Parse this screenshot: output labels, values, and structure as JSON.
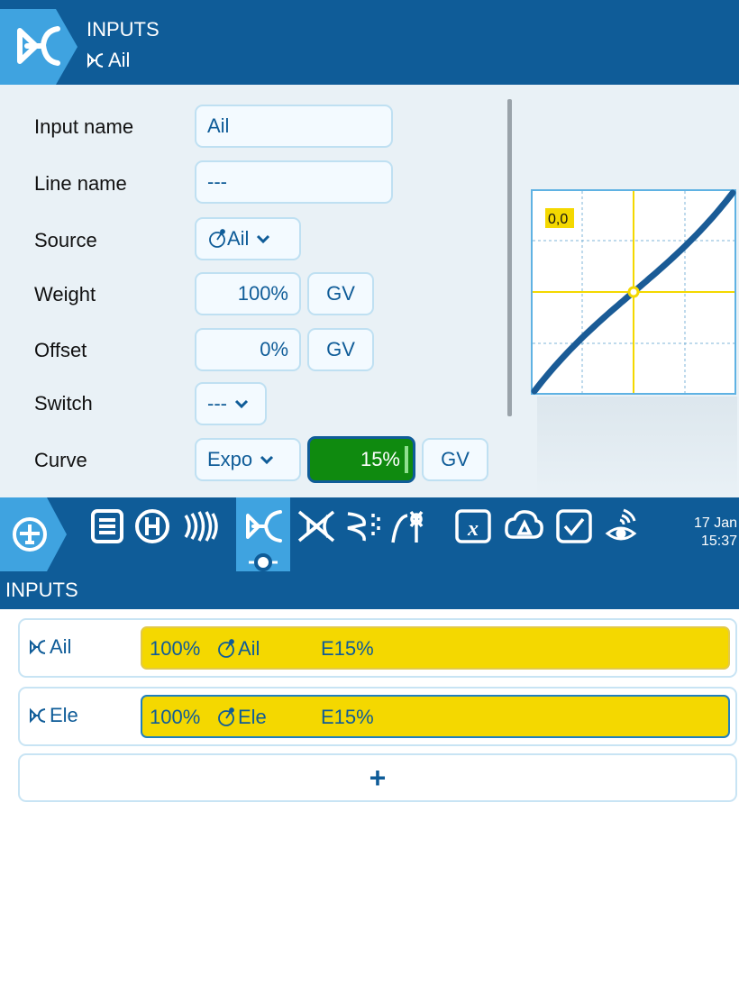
{
  "dialog": {
    "title": "INPUTS",
    "subtitle": "Ail",
    "fields": {
      "input_name": {
        "label": "Input name",
        "value": "Ail"
      },
      "line_name": {
        "label": "Line name",
        "value": "---"
      },
      "source": {
        "label": "Source",
        "value": "Ail"
      },
      "weight": {
        "label": "Weight",
        "value": "100%",
        "gv_label": "GV"
      },
      "offset": {
        "label": "Offset",
        "value": "0%",
        "gv_label": "GV"
      },
      "switch": {
        "label": "Switch",
        "value": "---"
      },
      "curve": {
        "label": "Curve",
        "type": "Expo",
        "value": "15%",
        "gv_label": "GV"
      }
    },
    "preview": {
      "readout": "0,0",
      "expo_percent": 15,
      "cursor": [
        0,
        0
      ]
    }
  },
  "topbar": {
    "icons": [
      "model-setup-icon",
      "notes-icon",
      "heli-icon",
      "flight-modes-icon",
      "inputs-icon",
      "mixes-icon",
      "outputs-icon",
      "curves-icon",
      "global-variables-icon",
      "logical-switches-icon",
      "special-functions-icon",
      "telemetry-icon"
    ],
    "date": "17 Jan",
    "time": "15:37"
  },
  "section": {
    "title": "INPUTS"
  },
  "inputs": [
    {
      "name": "Ail",
      "weight": "100%",
      "source": "Ail",
      "curve": "E15%",
      "selected": false
    },
    {
      "name": "Ele",
      "weight": "100%",
      "source": "Ele",
      "curve": "E15%",
      "selected": true
    }
  ],
  "add_label": "+",
  "colors": {
    "header_blue": "#0f5c98",
    "active_tab": "#3fa3e0",
    "line_yellow": "#f4d800",
    "edit_green": "#0f8a0f",
    "curve_cursor": "#f4d800"
  }
}
